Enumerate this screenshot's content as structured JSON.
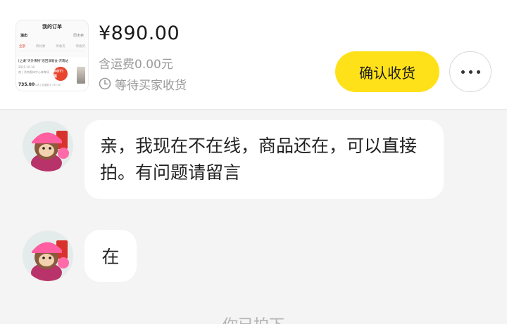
{
  "order": {
    "thumbnail": {
      "title": "我的订单",
      "tabs": [
        "演出",
        "",
        "周末卖"
      ],
      "filters": [
        "全部",
        "待付款",
        "待收货",
        "待收货"
      ],
      "event_line": "[之谦“天外来物”巡回演唱会-济南站",
      "event_date": "2025.10.18",
      "event_venue": "南 | 济南奥体中心体育场",
      "badge": "HOT! 票",
      "price": "735.00",
      "meta": "1张 1场 | 总金额 ¥ 735.00"
    },
    "price": "¥890.00",
    "shipping": "含运费0.00元",
    "status": "等待买家收货",
    "confirm_label": "确认收货"
  },
  "messages": [
    {
      "text": "亲，我现在不在线，商品还在，可以直接拍。有问题请留言"
    },
    {
      "text": "在"
    }
  ],
  "system_note": "你已拍下",
  "colors": {
    "accent": "#ffe11a",
    "background": "#f4f4f4",
    "muted": "#9a9a9a"
  }
}
